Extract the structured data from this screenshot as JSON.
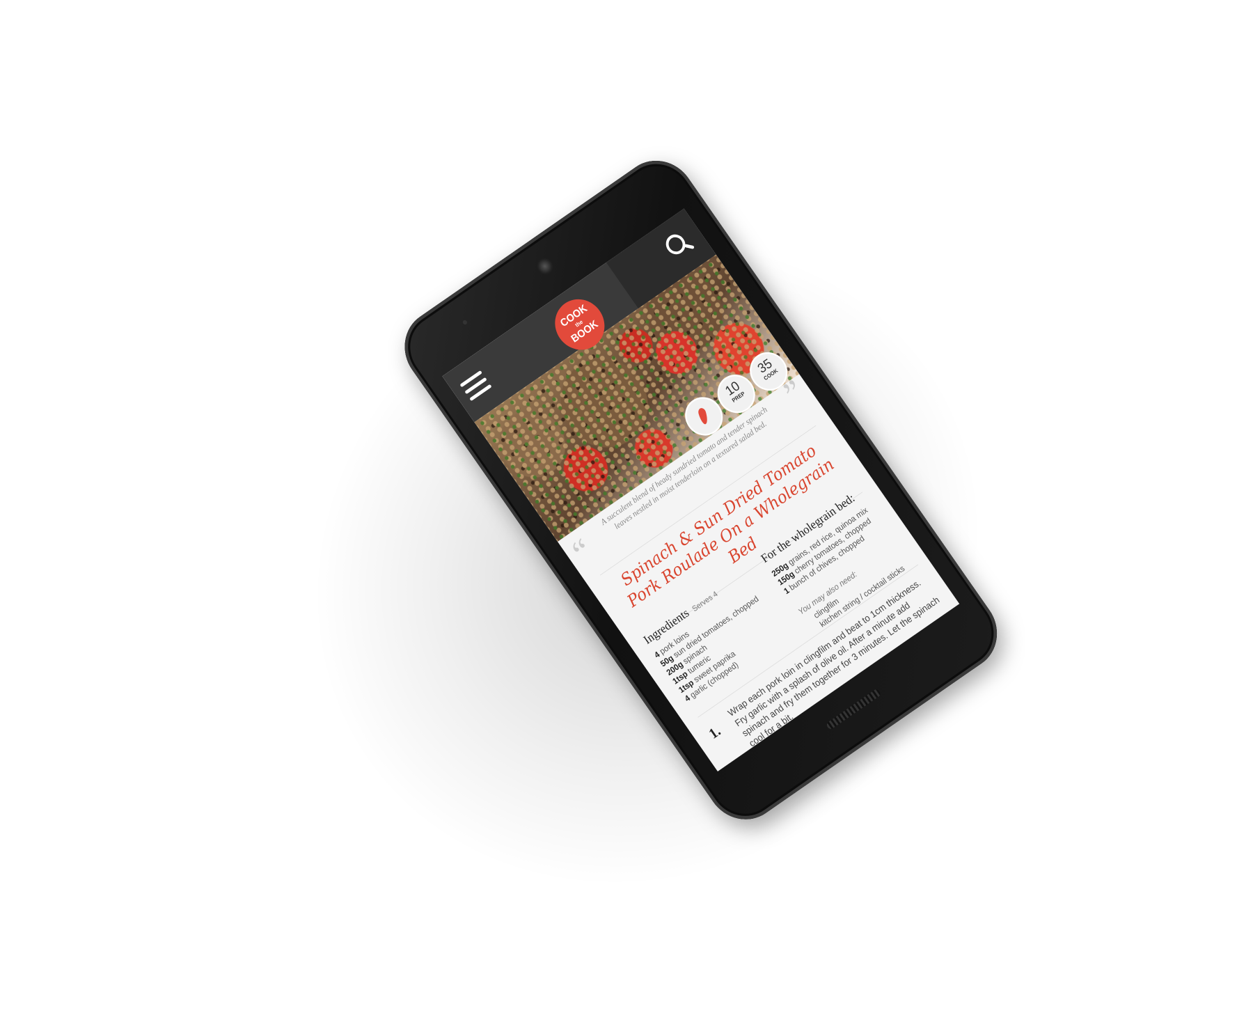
{
  "app": {
    "logo": {
      "line1": "COOK",
      "line2": "the",
      "line3": "BOOK",
      "color": "#e24a3b"
    },
    "icons": {
      "menu": "hamburger-menu-icon",
      "search": "search-icon",
      "chili": "chili-pepper-icon"
    }
  },
  "recipe": {
    "badges": {
      "prep": {
        "value": "10",
        "label": "PREP"
      },
      "cook": {
        "value": "35",
        "label": "COOK"
      }
    },
    "quote_open": "“",
    "quote_close": "”",
    "tagline": "A succulent blend of heady sundried tomato and tender spinach leaves nestled in moist tenderloin on a textured salad bed.",
    "title": "Spinach & Sun Dried Tomato Pork Roulade On a Wholegrain Bed",
    "ingredients": {
      "heading": "Ingredients",
      "serves": "Serves 4",
      "items": [
        {
          "qty": "4",
          "name": "pork loins"
        },
        {
          "qty": "50g",
          "name": "sun dried tomatoes, chopped"
        },
        {
          "qty": "200g",
          "name": "spinach"
        },
        {
          "qty": "1tsp",
          "name": "tumeric"
        },
        {
          "qty": "1tsp",
          "name": "sweet paprika"
        },
        {
          "qty": "4",
          "name": "garlic (chopped)"
        }
      ]
    },
    "wholegrain": {
      "heading": "For the wholegrain bed:",
      "items": [
        {
          "qty": "250g",
          "name": "grains, red rice, quinoa mix"
        },
        {
          "qty": "150g",
          "name": "cherry tomatoes, chopped"
        },
        {
          "qty": "1",
          "name": "bunch of chives, chopped"
        }
      ],
      "also_title": "You may also need:",
      "also_items": [
        "clingfilm",
        "kitchen string / cocktail sticks"
      ]
    },
    "steps": [
      {
        "num": "1.",
        "text": "Wrap each pork loin in clingfilm and beat to 1cm thickness. Fry garlic with a splash of olive oil. After a minute add spinach and fry them together for 3 minutes. Let the spinach cool for a bit."
      }
    ],
    "accent_color": "#d9452f"
  }
}
